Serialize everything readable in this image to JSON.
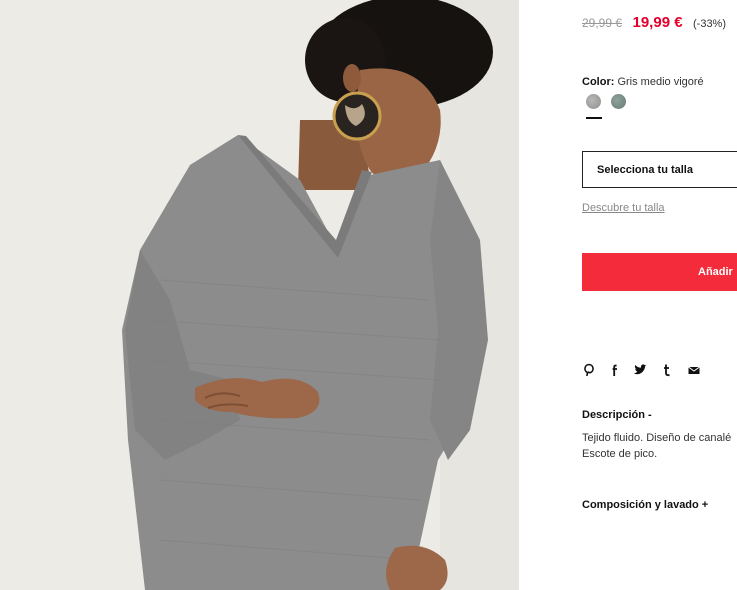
{
  "product": {
    "old_price": "29,99 €",
    "price": "19,99 €",
    "discount": "(-33%)",
    "color_label": "Color:",
    "color_value": "Gris medio vigoré",
    "swatches": [
      "gray-swatch",
      "green-gray-swatch"
    ],
    "size_select_label": "Selecciona tu talla",
    "size_guide_link": "Descubre tu talla",
    "add_to_bag_label": "Añadir",
    "share_icons": [
      "pinterest-icon",
      "facebook-icon",
      "twitter-icon",
      "tumblr-icon",
      "email-icon"
    ],
    "description_title": "Descripción -",
    "description_lines": [
      "Tejido fluido. Diseño de canalé",
      "Escote de pico."
    ],
    "composition_title": "Composición y lavado +"
  },
  "colors": {
    "price_accent": "#e4002b",
    "button": "#f32b3a",
    "photo_background": "#ecebe6",
    "sweater": "#8c8c8c"
  }
}
